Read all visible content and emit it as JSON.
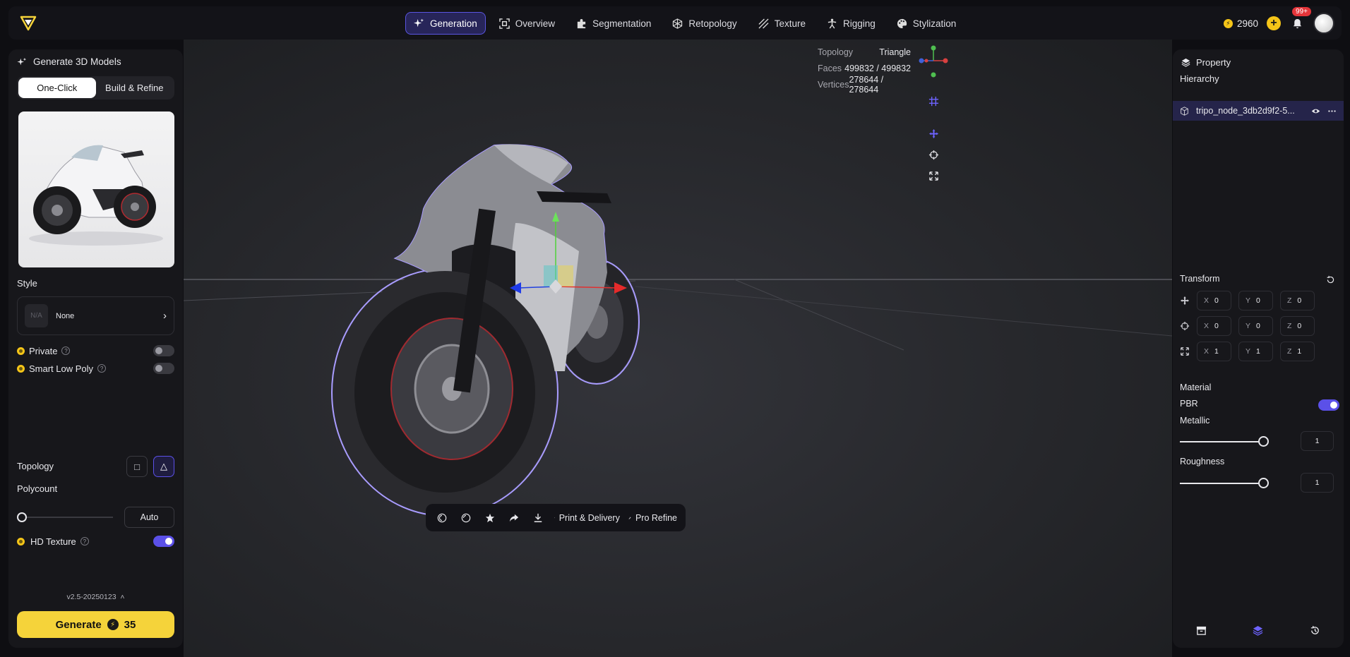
{
  "app": {
    "logo": "tripo-logo-icon"
  },
  "nav": {
    "items": [
      {
        "label": "Generation",
        "icon": "sparkle-icon",
        "active": true
      },
      {
        "label": "Overview",
        "icon": "scan-icon"
      },
      {
        "label": "Segmentation",
        "icon": "puzzle-icon"
      },
      {
        "label": "Retopology",
        "icon": "cube-mesh-icon"
      },
      {
        "label": "Texture",
        "icon": "stripes-icon"
      },
      {
        "label": "Rigging",
        "icon": "figure-icon"
      },
      {
        "label": "Stylization",
        "icon": "palette-icon"
      }
    ]
  },
  "account": {
    "credits": "2960",
    "notifications_badge": "99+"
  },
  "left": {
    "title": "Generate 3D Models",
    "modes": [
      "One-Click",
      "Build & Refine"
    ],
    "style_label": "Style",
    "style_placeholder": "N/A",
    "style_value": "None",
    "private_label": "Private",
    "help": "?",
    "smart_low_poly_label": "Smart Low Poly",
    "topology_label": "Topology",
    "polycount_label": "Polycount",
    "polycount_value": "Auto",
    "hd_texture_label": "HD Texture",
    "version": "v2.5-20250123",
    "generate_label": "Generate",
    "generate_cost": "35"
  },
  "viewport": {
    "stats": [
      {
        "key": "Topology",
        "value": "Triangle"
      },
      {
        "key": "Faces",
        "value": "499832 / 499832"
      },
      {
        "key": "Vertices",
        "value": "278644 / 278644"
      }
    ],
    "bottom_bar": {
      "print_label": "Print & Delivery",
      "refine_label": "Pro Refine"
    }
  },
  "right": {
    "property_label": "Property",
    "hierarchy_label": "Hierarchy",
    "node_name": "tripo_node_3db2d9f2-5...",
    "transform_label": "Transform",
    "transform_rows": [
      {
        "icon": "move-icon",
        "x": "0",
        "y": "0",
        "z": "0"
      },
      {
        "icon": "rotate-icon",
        "x": "0",
        "y": "0",
        "z": "0"
      },
      {
        "icon": "scale-icon",
        "x": "1",
        "y": "1",
        "z": "1"
      }
    ],
    "axis_x": "X",
    "axis_y": "Y",
    "axis_z": "Z",
    "material_label": "Material",
    "pbr_label": "PBR",
    "metallic_label": "Metallic",
    "metallic_value": "1",
    "roughness_label": "Roughness",
    "roughness_value": "1"
  },
  "colors": {
    "accent": "#5b50e8",
    "gold": "#f5d33a",
    "panel": "#17171b",
    "badge": "#e5353a"
  }
}
